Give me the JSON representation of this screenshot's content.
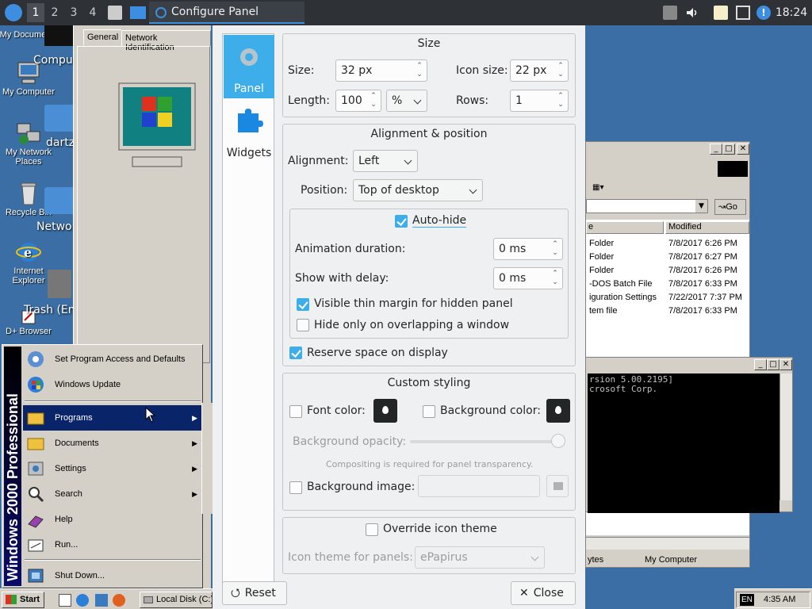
{
  "top_panel": {
    "workspaces": [
      "1",
      "2",
      "3",
      "4"
    ],
    "active_window": "Configure Panel",
    "clock": "18:24"
  },
  "desktop": {
    "win_icons": [
      "My Docume",
      "My Computer",
      "My Network Places",
      "Recycle Bin",
      "Internet Explorer",
      "D+ Browser"
    ],
    "linux_labels": [
      "Computer",
      "dartz",
      "Network",
      "Trash (Empty)"
    ]
  },
  "prop_window": {
    "tabs": [
      "General",
      "Network Identification"
    ]
  },
  "explorer": {
    "column_header": "Modified",
    "col_left": "e",
    "go_label": "Go",
    "rows": [
      {
        "name": "Folder",
        "modified": "7/8/2017 6:26 PM"
      },
      {
        "name": "Folder",
        "modified": "7/8/2017 6:27 PM"
      },
      {
        "name": "Folder",
        "modified": "7/8/2017 6:26 PM"
      },
      {
        "name": "-DOS Batch File",
        "modified": "7/8/2017 6:33 PM"
      },
      {
        "name": "iguration Settings",
        "modified": "7/22/2017 7:37 PM"
      },
      {
        "name": "tem file",
        "modified": "7/8/2017 6:33 PM"
      }
    ],
    "status_left": "ytes",
    "status_right": "My Computer"
  },
  "cmd": {
    "lines": [
      "rsion 5.00.2195]",
      "crosoft Corp."
    ]
  },
  "start_menu": {
    "banner": "Windows 2000 Professional",
    "top_items": [
      "Set Program Access and Defaults",
      "Windows Update"
    ],
    "items": [
      "Programs",
      "Documents",
      "Settings",
      "Search",
      "Help",
      "Run...",
      "Shut Down..."
    ]
  },
  "win_taskbar": {
    "start_label": "Start",
    "disk_button": "Local Disk (C:)",
    "tray_lang": "EN",
    "tray_time": "4:35 AM"
  },
  "dialog": {
    "sidebar": {
      "panel": "Panel",
      "widgets": "Widgets"
    },
    "size_group": {
      "title": "Size",
      "size_label": "Size:",
      "size_value": "32 px",
      "icon_size_label": "Icon size:",
      "icon_size_value": "22 px",
      "length_label": "Length:",
      "length_value": "100",
      "length_unit": "%",
      "rows_label": "Rows:",
      "rows_value": "1"
    },
    "align_group": {
      "title": "Alignment & position",
      "alignment_label": "Alignment:",
      "alignment_value": "Left",
      "position_label": "Position:",
      "position_value": "Top of desktop",
      "autohide_label": "Auto-hide",
      "anim_label": "Animation duration:",
      "anim_value": "0 ms",
      "delay_label": "Show with delay:",
      "delay_value": "0 ms",
      "thin_margin_label": "Visible thin margin for hidden panel",
      "overlap_label": "Hide only on overlapping a window",
      "reserve_label": "Reserve space on display"
    },
    "style_group": {
      "title": "Custom styling",
      "font_color_label": "Font color:",
      "bg_color_label": "Background color:",
      "opacity_label": "Background opacity:",
      "compositing_note": "Compositing is required for panel transparency.",
      "bg_image_label": "Background image:"
    },
    "icon_group": {
      "override_label": "Override icon theme",
      "theme_label": "Icon theme for panels:",
      "theme_value": "ePapirus"
    },
    "reset_label": "Reset",
    "close_label": "Close"
  },
  "colors": {
    "accent": "#3daee9",
    "dialog_bg": "#eff0f1",
    "desktop_bg": "#3a6ea5",
    "win_face": "#d4d0c8",
    "selection": "#0a246a"
  },
  "checks": {
    "autohide": true,
    "thin_margin": true,
    "overlap": false,
    "reserve": true,
    "font_color": false,
    "bg_color": false,
    "bg_image": false,
    "override_icons": false
  }
}
